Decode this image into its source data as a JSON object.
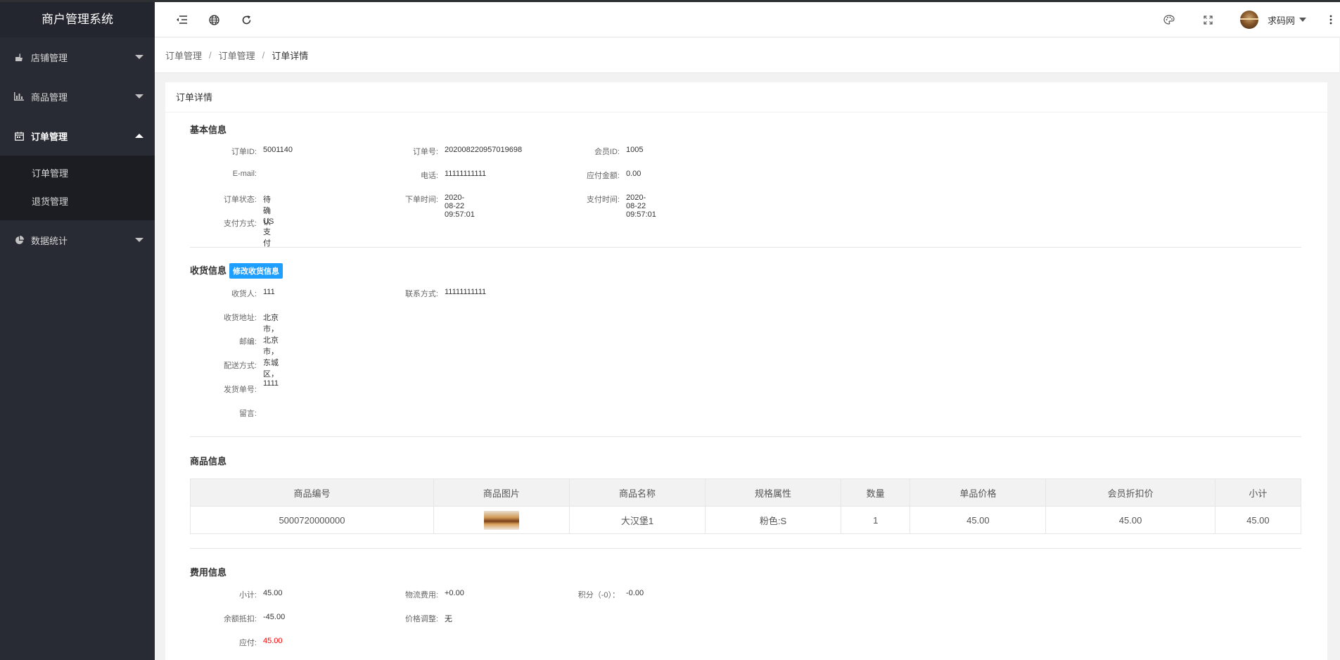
{
  "sidebar": {
    "title": "商户管理系统",
    "items": [
      {
        "label": "店铺管理",
        "icon": "hand-icon"
      },
      {
        "label": "商品管理",
        "icon": "bar-chart-icon"
      },
      {
        "label": "订单管理",
        "icon": "calendar-icon"
      },
      {
        "label": "数据统计",
        "icon": "pie-chart-icon"
      }
    ],
    "sub_items": [
      "订单管理",
      "退货管理"
    ]
  },
  "header": {
    "user_name": "求码网"
  },
  "breadcrumb": [
    "订单管理",
    "订单管理",
    "订单详情"
  ],
  "card_title": "订单详情",
  "basic": {
    "title": "基本信息",
    "fields": [
      {
        "label": "订单ID:",
        "value": "5001140"
      },
      {
        "label": "订单号:",
        "value": "202008220957019698"
      },
      {
        "label": "会员ID:",
        "value": "1005"
      },
      {
        "label": "E-mail:",
        "value": ""
      },
      {
        "label": "电话:",
        "value": "11111111111"
      },
      {
        "label": "应付金额:",
        "value": "0.00"
      },
      {
        "label": "订单状态:",
        "value": "待确认"
      },
      {
        "label": "下单时间:",
        "value": "2020-08-22 09:57:01"
      },
      {
        "label": "支付时间:",
        "value": "2020-08-22 09:57:01"
      },
      {
        "label": "支付方式:",
        "value": "US支付"
      }
    ]
  },
  "shipping": {
    "title": "收货信息",
    "edit_label": "修改收货信息",
    "fields": [
      {
        "label": "收货人:",
        "value": "111"
      },
      {
        "label": "联系方式:",
        "value": "11111111111"
      },
      {
        "label": "收货地址:",
        "value": "北京市，北京市，东城区，1111"
      },
      {
        "label": "邮编:",
        "value": ""
      },
      {
        "label": "配送方式:",
        "value": ""
      },
      {
        "label": "发货单号:",
        "value": ""
      },
      {
        "label": "留言:",
        "value": ""
      }
    ]
  },
  "goods": {
    "title": "商品信息",
    "columns": [
      "商品编号",
      "商品图片",
      "商品名称",
      "规格属性",
      "数量",
      "单品价格",
      "会员折扣价",
      "小计"
    ],
    "rows": [
      {
        "id": "5000720000000",
        "name": "大汉堡1",
        "spec": "粉色:S",
        "qty": "1",
        "price": "45.00",
        "member_price": "45.00",
        "subtotal": "45.00"
      }
    ]
  },
  "fees": {
    "title": "费用信息",
    "fields": [
      {
        "label": "小计:",
        "value": "45.00"
      },
      {
        "label": "物流费用:",
        "value": "+0.00"
      },
      {
        "label": "积分（-0）：",
        "value": "-0.00"
      },
      {
        "label": "余额抵扣:",
        "value": "-45.00"
      },
      {
        "label": "价格调整:",
        "value": "无"
      },
      {
        "label": "应付:",
        "value": "45.00"
      }
    ]
  },
  "colors": {
    "sidebar_bg": "#282b33",
    "accent_blue": "#1e9fff",
    "payable_red": "#ff0000"
  }
}
